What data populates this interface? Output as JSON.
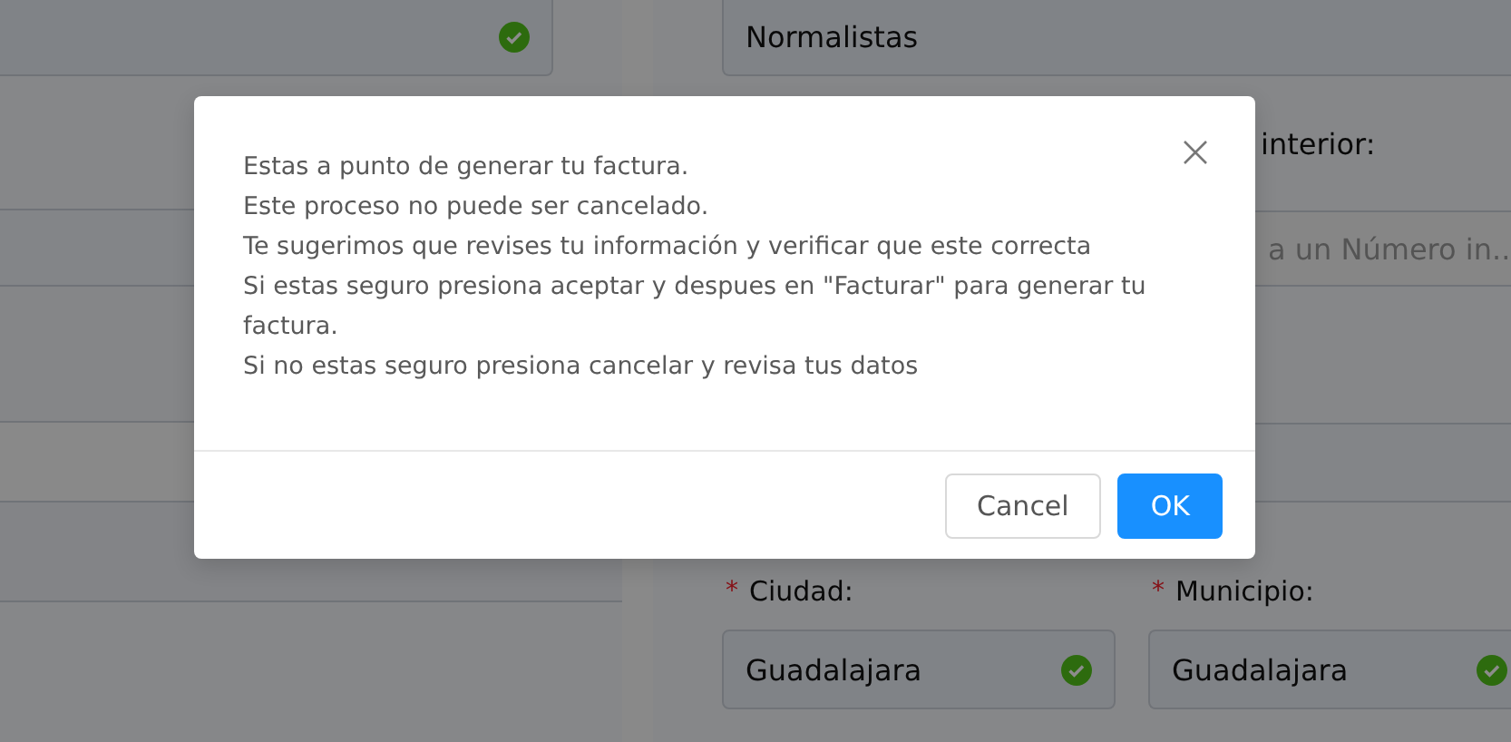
{
  "form": {
    "left_field": {
      "validated": true
    },
    "address_field": {
      "value": "Normalistas"
    },
    "interior_label": "interior:",
    "interior_field": {
      "placeholder": "a un Número in..."
    },
    "city": {
      "required_mark": "*",
      "label": "Ciudad:",
      "required": true,
      "value": "Guadalajara",
      "validated": true
    },
    "municipality": {
      "required_mark": "*",
      "label": "Municipio:",
      "required": true,
      "value": "Guadalajara",
      "validated": true
    }
  },
  "dialog": {
    "lines": [
      "Estas a punto de generar tu factura.",
      "Este proceso no puede ser cancelado.",
      "Te sugerimos que revises tu información y verificar que este correcta",
      "Si estas seguro presiona aceptar y despues en \"Facturar\" para generar tu factura.",
      "Si no estas seguro presiona cancelar y revisa tus datos"
    ],
    "buttons": [
      {
        "label": "Cancel",
        "kind": "secondary"
      },
      {
        "label": "OK",
        "kind": "primary"
      }
    ]
  }
}
